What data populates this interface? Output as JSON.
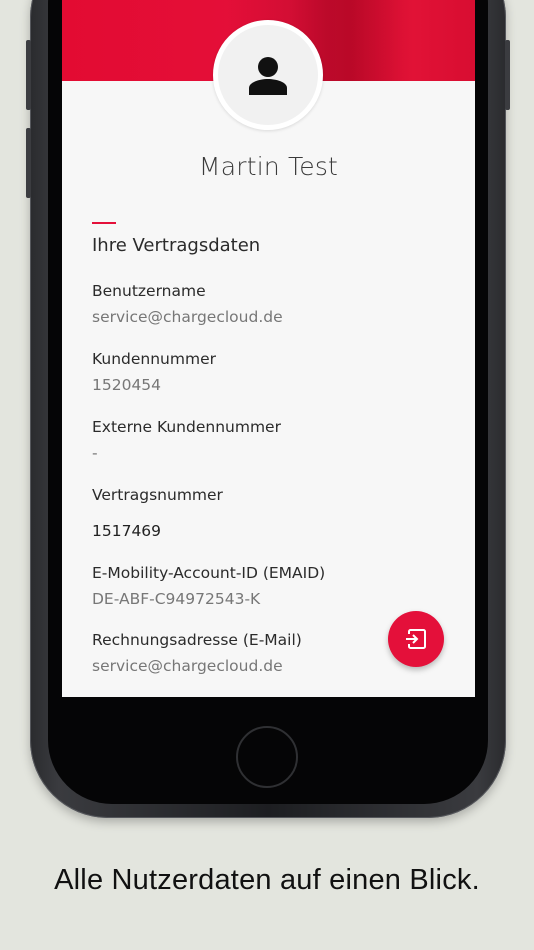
{
  "profile": {
    "name": "Martin Test",
    "avatar_icon": "person-icon"
  },
  "section": {
    "title": "Ihre Vertragsdaten"
  },
  "fields": [
    {
      "label": "Benutzername",
      "value": "service@chargecloud.de"
    },
    {
      "label": "Kundennummer",
      "value": "1520454"
    },
    {
      "label": "Externe Kundennummer",
      "value": "-"
    },
    {
      "label": "Vertragsnummer",
      "value": "1517469"
    },
    {
      "label": "E-Mobility-Account-ID (EMAID)",
      "value": "DE-ABF-C94972543-K"
    },
    {
      "label": "Rechnungsadresse (E-Mail)",
      "value": "service@chargecloud.de"
    }
  ],
  "fab": {
    "icon": "logout-icon"
  },
  "caption": "Alle Nutzerdaten auf einen Blick.",
  "colors": {
    "accent": "#e4103a",
    "background": "#e3e5de",
    "screen": "#f7f7f7"
  }
}
